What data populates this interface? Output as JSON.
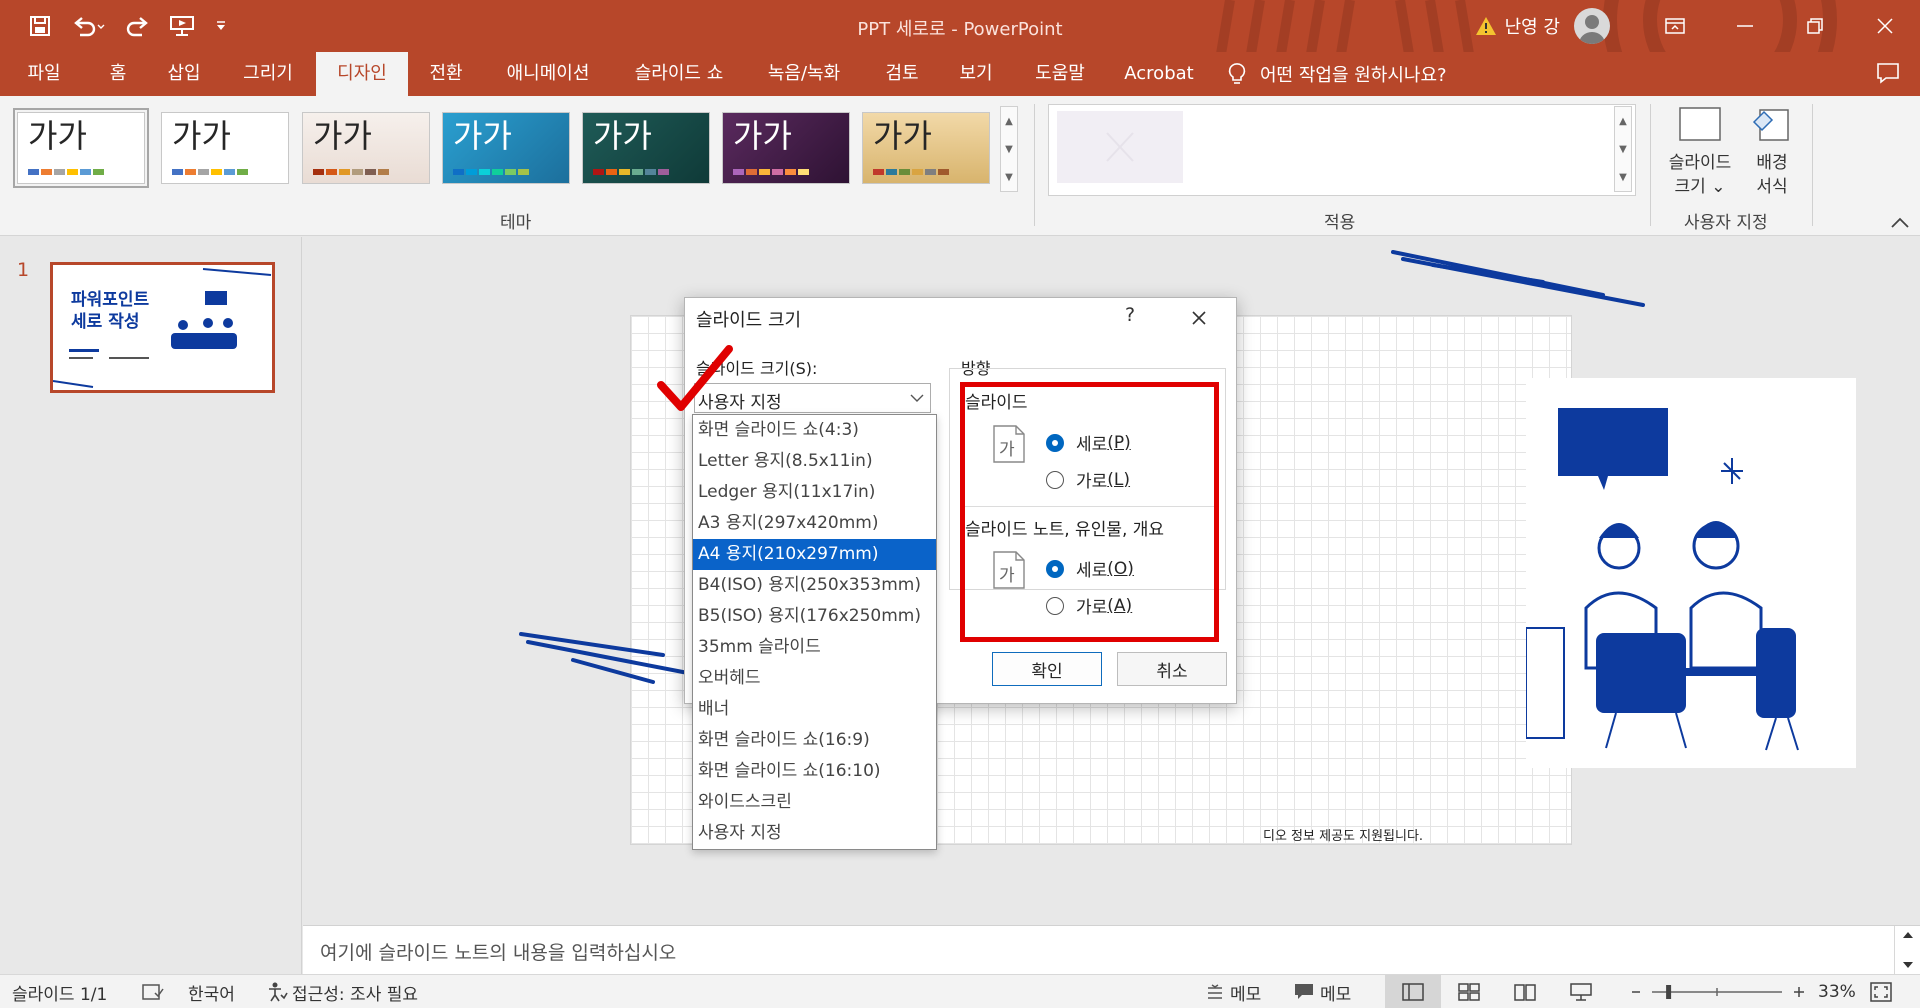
{
  "window": {
    "doc_title": "PPT 세로로  -  PowerPoint",
    "user_name": "난영 강",
    "accent": "#b7472a"
  },
  "ribbon_tabs": [
    "파일",
    "홈",
    "삽입",
    "그리기",
    "디자인",
    "전환",
    "애니메이션",
    "슬라이드 쇼",
    "녹음/녹화",
    "검토",
    "보기",
    "도움말",
    "Acrobat"
  ],
  "active_tab": "디자인",
  "tell_me": "어떤 작업을 원하시나요?",
  "ribbon": {
    "theme_sample": "가가",
    "group_themes": "테마",
    "group_variants": "적용",
    "group_customize": "사용자 지정",
    "slide_size_btn": [
      "슬라이드",
      "크기 ⌄"
    ],
    "bg_format_btn": [
      "배경",
      "서식"
    ]
  },
  "thumbnail": {
    "number": "1",
    "title_line1": "파워포인트",
    "title_line2": "세로 작성"
  },
  "slide": {
    "caption": "디오 정보 제공도 지원됩니다."
  },
  "notes_placeholder": "여기에 슬라이드 노트의 내용을 입력하십시오",
  "statusbar": {
    "slide_count": "슬라이드 1/1",
    "language": "한국어",
    "accessibility": "접근성: 조사 필요",
    "notes_btn": "메모",
    "comments_btn": "메모",
    "zoom": "33%",
    "zoom_level": 0.33
  },
  "dialog": {
    "title": "슬라이드 크기",
    "help": "?",
    "size_label": "슬라이드 크기(S):",
    "size_label_key": "S",
    "combo_value": "사용자 지정",
    "orientation_label": "방향",
    "slide_group": "슬라이드",
    "slide_portrait": "세로",
    "slide_portrait_key": "(P)",
    "slide_landscape": "가로",
    "slide_landscape_key": "(L)",
    "notes_group": "슬라이드 노트, 유인물, 개요",
    "notes_portrait": "세로",
    "notes_portrait_key": "(O)",
    "notes_landscape": "가로",
    "notes_landscape_key": "(A)",
    "ok": "확인",
    "cancel": "취소",
    "page_glyph": "가"
  },
  "dropdown_items": [
    "화면 슬라이드 쇼(4:3)",
    "Letter 용지(8.5x11in)",
    "Ledger 용지(11x17in)",
    "A3 용지(297x420mm)",
    "A4 용지(210x297mm)",
    "B4(ISO) 용지(250x353mm)",
    "B5(ISO) 용지(176x250mm)",
    "35mm 슬라이드",
    "오버헤드",
    "배너",
    "화면 슬라이드 쇼(16:9)",
    "화면 슬라이드 쇼(16:10)",
    "와이드스크린",
    "사용자 지정"
  ],
  "dropdown_selected_index": 4
}
